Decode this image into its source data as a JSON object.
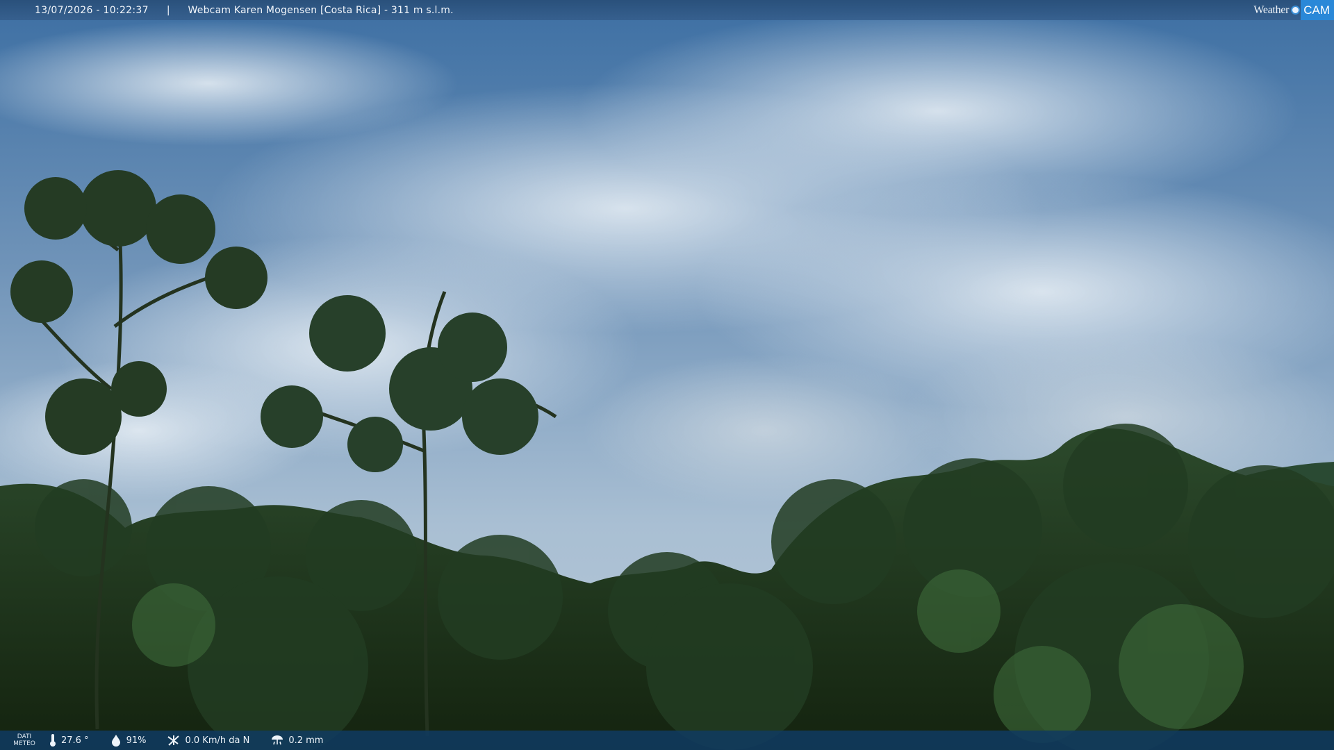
{
  "header": {
    "datetime": "13/07/2026 - 10:22:37",
    "separator": "|",
    "title": "Webcam Karen Mogensen [Costa Rica]  - 311 m s.l.m."
  },
  "logo": {
    "word": "Weather",
    "cam": "CAM"
  },
  "footer": {
    "label_line1": "DATI",
    "label_line2": "METEO",
    "temperature": "27.6 °",
    "humidity": "91%",
    "wind": "0.0 Km/h da N",
    "rain": "0.2 mm"
  },
  "colors": {
    "sky_top": "#3d6fa3",
    "cloud": "#d6e2ec",
    "forest": "#1f3520",
    "brand_blue": "#2a88d8"
  },
  "icons": [
    "thermometer-icon",
    "humidity-drop-icon",
    "wind-icon",
    "rain-icon"
  ]
}
